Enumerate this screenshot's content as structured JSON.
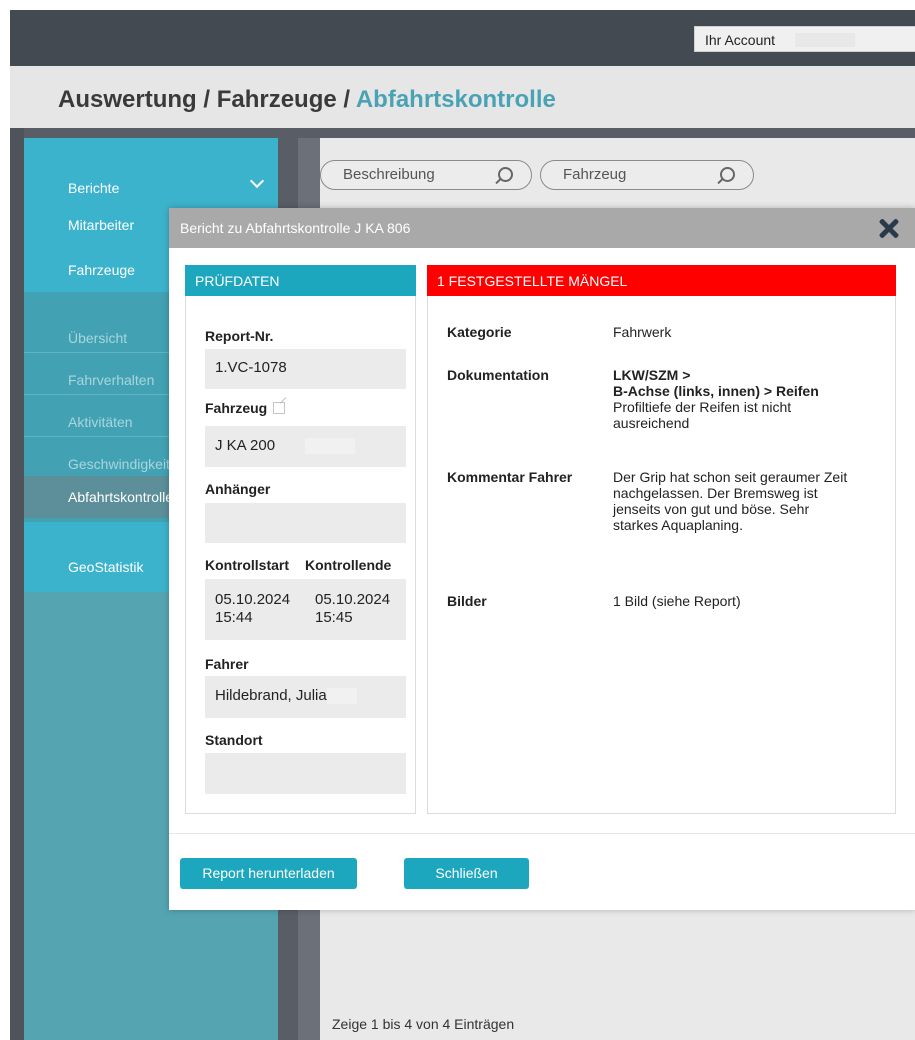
{
  "header": {
    "account_label": "Ihr Account"
  },
  "breadcrumb": {
    "part1": "Auswertung",
    "sep1": " / ",
    "part2": "Fahrzeuge",
    "sep2": " / ",
    "current": "Abfahrtskontrolle"
  },
  "sidebar": {
    "berichte": "Berichte",
    "mitarbeiter": "Mitarbeiter",
    "fahrzeuge": "Fahrzeuge",
    "sub_items": [
      "Übersicht",
      "Fahrverhalten",
      "Aktivitäten",
      "Geschwindigkeit",
      "Abfahrtskontrolle"
    ],
    "geostatistik": "GeoStatistik"
  },
  "search": {
    "beschreibung_placeholder": "Beschreibung",
    "fahrzeug_placeholder": "Fahrzeug"
  },
  "table_footer": "Zeige 1 bis 4 von 4 Einträgen",
  "modal": {
    "title": "Bericht zu Abfahrtskontrolle J KA 806",
    "left_panel": {
      "heading": "PRÜFDATEN",
      "report_nr_label": "Report-Nr.",
      "report_nr_value": "1.VC-1078",
      "fahrzeug_label": "Fahrzeug",
      "fahrzeug_value": "J KA 200",
      "anhaenger_label": "Anhänger",
      "anhaenger_value": "",
      "kontrollstart_label": "Kontrollstart",
      "kontrollende_label": "Kontrollende",
      "start_date": "05.10.2024",
      "start_time": "15:44",
      "end_date": "05.10.2024",
      "end_time": "15:45",
      "fahrer_label": "Fahrer",
      "fahrer_value": "Hildebrand, Julia",
      "standort_label": "Standort",
      "standort_value": ""
    },
    "right_panel": {
      "heading": "1 FESTGESTELLTE MÄNGEL",
      "kategorie_label": "Kategorie",
      "kategorie_value": "Fahrwerk",
      "dokumentation_label": "Dokumentation",
      "dok_line1": "LKW/SZM >",
      "dok_line2": "B-Achse (links, innen) > Reifen",
      "dok_text": "Profiltiefe der Reifen ist nicht ausreichend",
      "kommentar_label": "Kommentar Fahrer",
      "kommentar_value": "Der Grip hat schon seit geraumer Zeit nachgelassen. Der Bremsweg ist jenseits von gut und böse. Sehr starkes Aquaplaning.",
      "bilder_label": "Bilder",
      "bilder_value": "1 Bild (siehe Report)"
    },
    "download_button": "Report herunterladen",
    "close_button": "Schließen"
  },
  "colors": {
    "accent_teal": "#1da7be",
    "defect_red": "#ff0000",
    "sidebar_teal": "#3cb3cc",
    "breadcrumb_active": "#4aa2b5"
  }
}
